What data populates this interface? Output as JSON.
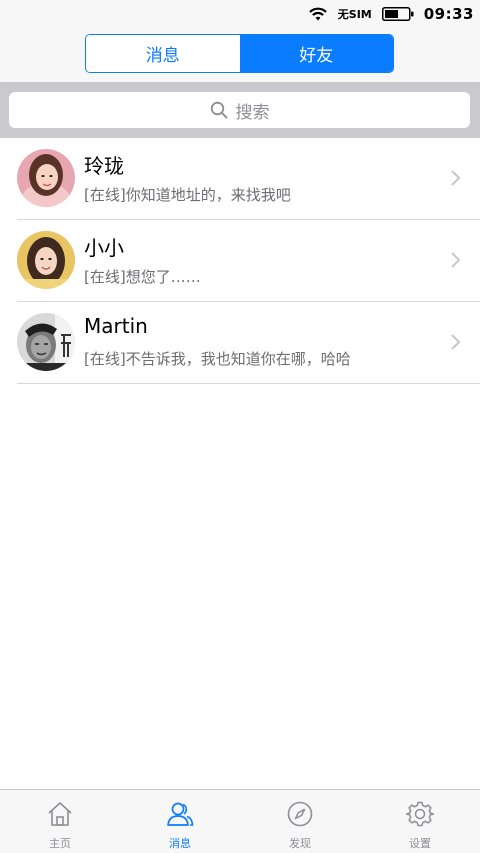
{
  "status_bar": {
    "carrier": "无SIM",
    "time": "09:33"
  },
  "segmented": {
    "left_label": "消息",
    "right_label": "好友",
    "selected": "好友"
  },
  "search": {
    "placeholder": "搜索"
  },
  "friends": [
    {
      "name": "玲珑",
      "status_message": "[在线]你知道地址的，来找我吧"
    },
    {
      "name": "小小",
      "status_message": "[在线]想您了……"
    },
    {
      "name": "Martin",
      "status_message": "[在线]不告诉我，我也知道你在哪，哈哈"
    }
  ],
  "tab_bar": {
    "tabs": [
      {
        "label": "主页",
        "icon": "home-icon"
      },
      {
        "label": "消息",
        "icon": "contacts-icon"
      },
      {
        "label": "发现",
        "icon": "compass-icon"
      },
      {
        "label": "设置",
        "icon": "gear-icon"
      }
    ],
    "active": "消息"
  },
  "colors": {
    "accent": "#0a7cff",
    "inactive_tab": "#8e8e93",
    "search_background": "#c9c9ce"
  }
}
